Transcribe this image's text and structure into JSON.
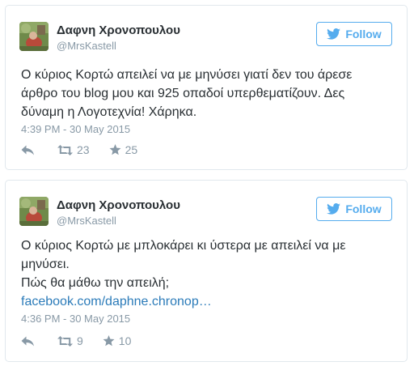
{
  "tweets": [
    {
      "author": {
        "name": "Δαφνη Χρονοπουλου",
        "handle": "@MrsKastell"
      },
      "follow_label": "Follow",
      "text_lines": [
        "Ο κύριος Κορτώ απειλεί να με μηνύσει γιατί δεν του άρεσε",
        "άρθρο του blog μου και 925  οπαδοί υπερθεματίζουν. Δες",
        "δύναμη η Λογοτεχνία! Χάρηκα."
      ],
      "timestamp": "4:39 PM - 30 May 2015",
      "retweets": "23",
      "favorites": "25"
    },
    {
      "author": {
        "name": "Δαφνη Χρονοπουλου",
        "handle": "@MrsKastell"
      },
      "follow_label": "Follow",
      "text_lines": [
        "Ο κύριος Κορτώ με μπλοκάρει κι ύστερα με απειλεί να με",
        "μηνύσει.",
        "Πώς θα μάθω την απειλή;"
      ],
      "link": "facebook.com/daphne.chronop…",
      "timestamp": "4:36 PM - 30 May 2015",
      "retweets": "9",
      "favorites": "10"
    }
  ],
  "icons": {
    "brand": "twitter-bird-icon",
    "reply": "reply-arrow-icon",
    "retweet": "retweet-icon",
    "favorite": "star-icon"
  },
  "colors": {
    "accent": "#55acee",
    "link": "#2b7bb9",
    "text": "#292f33",
    "muted": "#8899a6",
    "border": "#e1e8ed"
  }
}
